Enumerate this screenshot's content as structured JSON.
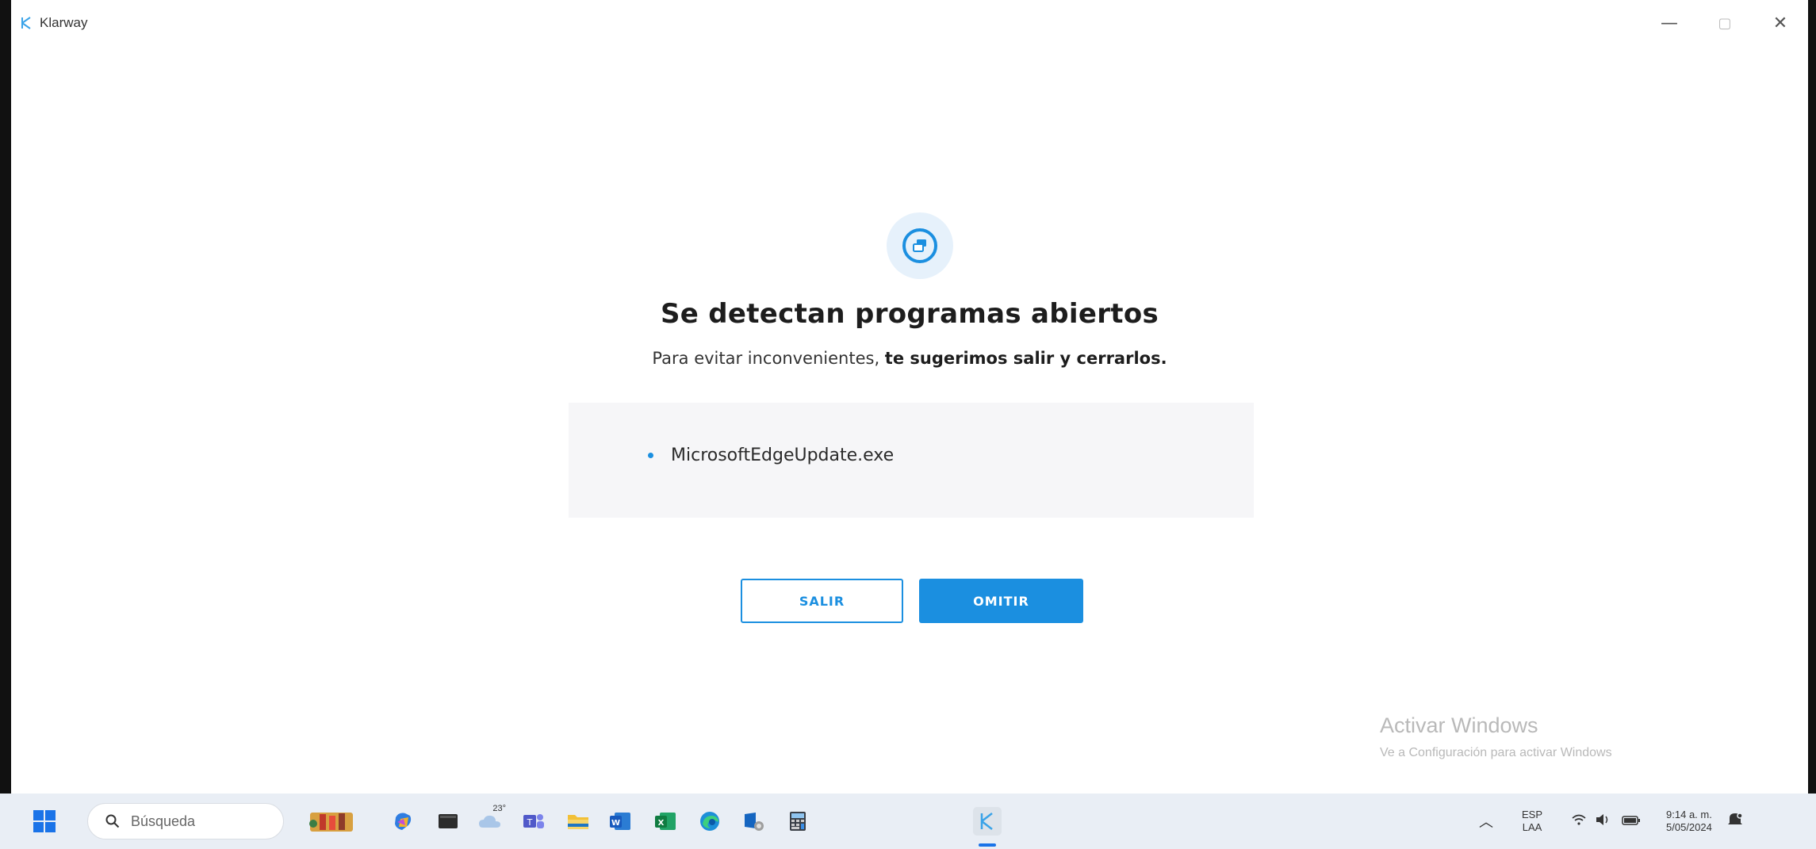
{
  "window": {
    "title": "Klarway",
    "controls": {
      "minimize": "—",
      "maximize": "▢",
      "close": "✕"
    }
  },
  "dialog": {
    "heading": "Se detectan programas abiertos",
    "subtitle_normal": "Para evitar inconvenientes, ",
    "subtitle_bold": "te sugerimos salir y cerrarlos.",
    "programs": [
      "MicrosoftEdgeUpdate.exe"
    ],
    "buttons": {
      "exit": "SALIR",
      "skip": "OMITIR"
    }
  },
  "watermark": {
    "title": "Activar Windows",
    "subtitle": "Ve a Configuración para activar Windows"
  },
  "taskbar": {
    "search_placeholder": "Búsqueda",
    "weather_temp": "23°",
    "apps": [
      "widgets-icon",
      "copilot-icon",
      "terminal-icon",
      "weather-icon",
      "teams-icon",
      "file-explorer-icon",
      "word-icon",
      "excel-icon",
      "edge-icon",
      "remote-desktop-icon",
      "calculator-icon",
      "klarway-icon"
    ],
    "tray": {
      "language_line1": "ESP",
      "language_line2": "LAA",
      "time": "9:14 a. m.",
      "date": "5/05/2024"
    }
  },
  "colors": {
    "accent": "#1b8fe0",
    "taskbar": "#e9eef5",
    "box_bg": "#f6f6f8"
  }
}
